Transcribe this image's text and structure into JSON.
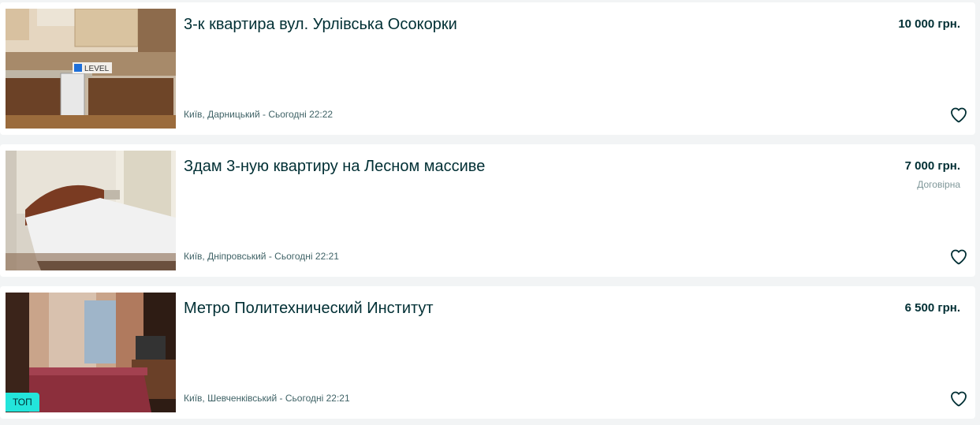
{
  "listings": [
    {
      "title": "3-к квартира вул. Урлівська Осокорки",
      "location": "Київ, Дарницький - Сьогодні 22:22",
      "price": "10 000 грн.",
      "negotiable": "",
      "photo_watermark": "LEVEL",
      "badge": ""
    },
    {
      "title": "Здам 3-ную квартиру на Лесном массиве",
      "location": "Київ, Дніпровський - Сьогодні 22:21",
      "price": "7 000 грн.",
      "negotiable": "Договірна",
      "badge": ""
    },
    {
      "title": "Метро Политехнический Институт",
      "location": "Київ, Шевченківський - Сьогодні 22:21",
      "price": "6 500 грн.",
      "negotiable": "",
      "badge": "ТОП"
    }
  ],
  "icons": {
    "favorite": "heart-outline-icon"
  },
  "colors": {
    "text_primary": "#002f34",
    "text_secondary": "#406367",
    "badge_top": "#23e5db",
    "background": "#f2f4f5"
  }
}
